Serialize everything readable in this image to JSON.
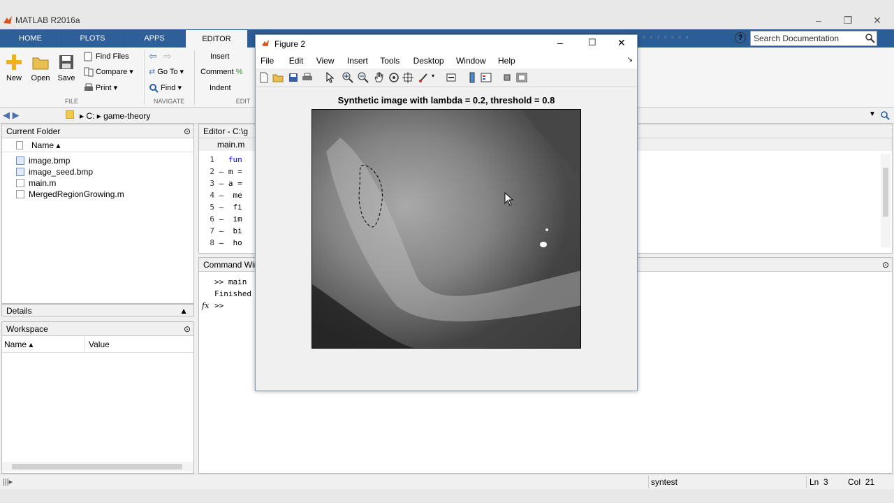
{
  "window": {
    "title": "MATLAB R2016a"
  },
  "tabs": [
    {
      "label": "HOME"
    },
    {
      "label": "PLOTS"
    },
    {
      "label": "APPS"
    },
    {
      "label": "EDITOR"
    }
  ],
  "ribbon": {
    "file": {
      "new": "New",
      "open": "Open",
      "save": "Save",
      "find_files": "Find Files",
      "compare": "Compare",
      "print": "Print",
      "group": "FILE"
    },
    "navigate": {
      "go_to": "Go To",
      "find": "Find",
      "group": "NAVIGATE"
    },
    "edit": {
      "insert": "Insert",
      "comment": "Comment",
      "indent": "Indent",
      "group": "EDIT"
    }
  },
  "search": {
    "placeholder": "Search Documentation"
  },
  "address": {
    "drive": "C:",
    "folder": "game-theory"
  },
  "current_folder": {
    "title": "Current Folder",
    "column": "Name",
    "files": [
      {
        "name": "image.bmp",
        "icon": "bmp-file-icon"
      },
      {
        "name": "image_seed.bmp",
        "icon": "bmp-file-icon"
      },
      {
        "name": "main.m",
        "icon": "m-file-icon"
      },
      {
        "name": "MergedRegionGrowing.m",
        "icon": "m-file-icon"
      }
    ]
  },
  "details": {
    "title": "Details"
  },
  "workspace": {
    "title": "Workspace",
    "col_name": "Name",
    "col_value": "Value"
  },
  "editor": {
    "title": "Editor - C:\\g",
    "tab": "main.m",
    "lines": [
      {
        "n": "1",
        "mark": "",
        "code": "fun"
      },
      {
        "n": "2",
        "mark": "–",
        "code": "m ="
      },
      {
        "n": "3",
        "mark": "–",
        "code": "a ="
      },
      {
        "n": "4",
        "mark": "–",
        "code": "me"
      },
      {
        "n": "5",
        "mark": "–",
        "code": "fi"
      },
      {
        "n": "6",
        "mark": "–",
        "code": "im"
      },
      {
        "n": "7",
        "mark": "–",
        "code": "bi"
      },
      {
        "n": "8",
        "mark": "–",
        "code": "ho"
      }
    ]
  },
  "command_window": {
    "title": "Command Win",
    "lines": [
      ">> main",
      "Finished"
    ],
    "prompt": ">>",
    "fx": "fx"
  },
  "figure": {
    "title": "Figure 2",
    "menu": [
      "File",
      "Edit",
      "View",
      "Insert",
      "Tools",
      "Desktop",
      "Window",
      "Help"
    ],
    "plot_title": "Synthetic image with lambda = 0.2, threshold = 0.8"
  },
  "status": {
    "text": "syntest",
    "ln_label": "Ln",
    "ln": "3",
    "col_label": "Col",
    "col": "21"
  },
  "colors": {
    "tab_bar": "#2b5e99",
    "accent": "#0072bd"
  }
}
